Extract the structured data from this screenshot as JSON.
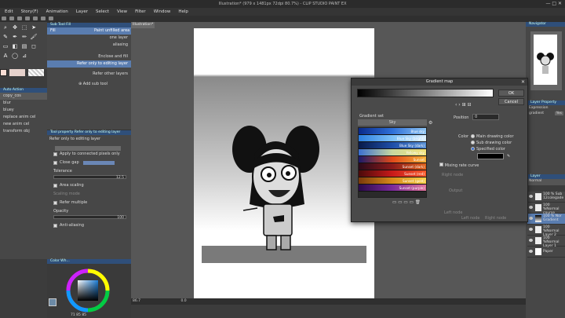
{
  "window": {
    "title": "Illustration* (979 x 1481px 72dpi 80.7%)  - CLIP STUDIO PAINT EX",
    "controls": "— □ ✕"
  },
  "menu": [
    "Edit",
    "Story(F)",
    "Animation",
    "Layer",
    "Select",
    "View",
    "Filter",
    "Window",
    "Help"
  ],
  "canvas": {
    "tab_label": "Illustration*",
    "zoom": "86.7",
    "rotate": "0.0"
  },
  "subtool": {
    "header": "Sub Tool Fill",
    "items": [
      {
        "label": "Fill",
        "extra": "Paint unfilled area"
      },
      {
        "label": "one layer"
      },
      {
        "label": "aliasing"
      },
      {
        "label": "Enclose and fill"
      },
      {
        "label": "Refer only to editing layer"
      },
      {
        "label": "Refer other layers"
      }
    ],
    "add_label": "Add sub tool"
  },
  "tool_property": {
    "header": "Tool property Refer only to editing layer",
    "title": "Refer only to editing layer",
    "apply_connected": "Apply to connected pixels only",
    "close_gap": "Close gap",
    "tolerance_label": "Tolerance",
    "tolerance_value": "12.5",
    "area_scaling": "Area scaling",
    "scaling_mode": "Scaling mode",
    "refer_multiple": "Refer multiple",
    "opacity_label": "Opacity",
    "opacity_value": "100",
    "anti_aliasing": "Anti-aliasing"
  },
  "left_layers": {
    "header": "Auto Action",
    "select_value": "copy_cos",
    "items": [
      "blur",
      "bluey",
      "replace anim cel",
      "new anim cel",
      "transform obj"
    ]
  },
  "color_panel": {
    "header": "Color Wh...",
    "readout": "71  85  85"
  },
  "right_panel": {
    "navigator": "Navigator",
    "layer_property": "Layer Property",
    "expression": "Expression",
    "gradient_label": "gradient",
    "gradient_value": "Yes",
    "layer_header": "Layer",
    "blend_mode": "Normal",
    "layers": [
      {
        "line1": "100 % Sub",
        "line2": "12colegade"
      },
      {
        "line1": "100 %Normal",
        "line2": "course"
      },
      {
        "line1": "100 % Nor",
        "line2": "Gradient",
        "selected": true
      },
      {
        "line1": "100 %Normal",
        "line2": "Layer 2"
      },
      {
        "line1": "100 %Normal",
        "line2": "Layer 1"
      },
      {
        "line1": "Paper",
        "line2": ""
      }
    ]
  },
  "dialog": {
    "title": "Gradient map",
    "ok": "OK",
    "cancel": "Cancel",
    "gradient_set_label": "Gradient set",
    "set_value": "Sky",
    "position_label": "Position",
    "position_value": "0",
    "color_label": "Color",
    "main_color": "Main drawing color",
    "sub_color": "Sub drawing color",
    "specified_color": "Specified color",
    "mixing_curve": "Mixing rate curve",
    "right_node": "Right node",
    "output_label": "Output",
    "left_node": "Left node",
    "footer": [
      "Left node",
      "Right node"
    ],
    "gradients": [
      {
        "name": "Blue sky",
        "colors": [
          "#0a2a8a",
          "#2e6fd8",
          "#8fc4f2"
        ]
      },
      {
        "name": "Blue Sky (bright)",
        "colors": [
          "#2c7fe0",
          "#7cc0f8",
          "#dbefff"
        ]
      },
      {
        "name": "Blue Sky (dark)",
        "colors": [
          "#081a4a",
          "#1e4ea8",
          "#5a93d6"
        ]
      },
      {
        "name": "Yellowy sky",
        "colors": [
          "#3a6fd0",
          "#c8d8a0",
          "#f2e27a"
        ]
      },
      {
        "name": "Sunset",
        "colors": [
          "#1a1a6a",
          "#e04a1a",
          "#f7b23a"
        ]
      },
      {
        "name": "Sunset (dark)",
        "colors": [
          "#2a0a1a",
          "#8a1a1a",
          "#e0621a"
        ]
      },
      {
        "name": "Sunset (red)",
        "colors": [
          "#4a0a0a",
          "#c81a1a",
          "#f85a2a"
        ]
      },
      {
        "name": "Sunset (gold)",
        "colors": [
          "#7a3a0a",
          "#d88a1a",
          "#f8d24a"
        ]
      },
      {
        "name": "Sunset (purple)",
        "colors": [
          "#2a0a4a",
          "#7a2a9a",
          "#e0729a"
        ]
      }
    ]
  }
}
